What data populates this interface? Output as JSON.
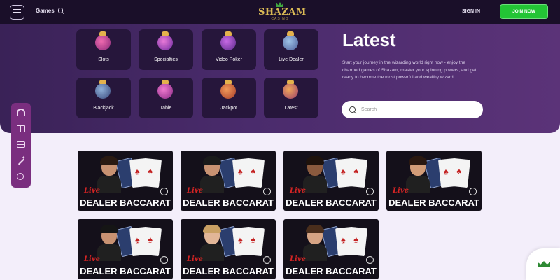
{
  "header": {
    "games_label": "Games",
    "logo_main": "SHAZAM",
    "logo_sub": "CASINO",
    "signin_label": "SIGN IN",
    "join_label": "JOIN NOW"
  },
  "categories": [
    {
      "label": "Slots",
      "icon": "potion-slots-icon"
    },
    {
      "label": "Specialties",
      "icon": "potion-specialties-icon"
    },
    {
      "label": "Video Poker",
      "icon": "potion-video-poker-icon"
    },
    {
      "label": "Live Dealer",
      "icon": "potion-live-dealer-icon"
    },
    {
      "label": "Blackjack",
      "icon": "potion-blackjack-icon"
    },
    {
      "label": "Table",
      "icon": "potion-table-icon"
    },
    {
      "label": "Jackpot",
      "icon": "potion-jackpot-icon"
    },
    {
      "label": "Latest",
      "icon": "potion-latest-icon"
    }
  ],
  "hero": {
    "title": "Latest",
    "description": "Start your journey in the wizarding world right now - enjoy the charmed games of Shazam, master your spinning powers, and get ready to become the most powerful and wealthy wizard!",
    "search_placeholder": "Search"
  },
  "siderail": {
    "icons": [
      "home-icon",
      "gift-icon",
      "card-icon",
      "magic-wand-icon",
      "chat-icon"
    ]
  },
  "games": [
    {
      "live": "Live",
      "name": "DEALER BACCARAT"
    },
    {
      "live": "Live",
      "name": "DEALER BACCARAT"
    },
    {
      "live": "Live",
      "name": "DEALER BACCARAT"
    },
    {
      "live": "Live",
      "name": "DEALER BACCARAT"
    },
    {
      "live": "Live",
      "name": "DEALER BACCARAT"
    },
    {
      "live": "Live",
      "name": "DEALER BACCARAT"
    },
    {
      "live": "Live",
      "name": "DEALER BACCARAT"
    }
  ],
  "colors": {
    "header_bg": "#1a0f29",
    "hero_bg": "#4a2b6c",
    "join_green": "#23c435",
    "live_red": "#d32424",
    "rail_purple": "#7a2e7f"
  }
}
